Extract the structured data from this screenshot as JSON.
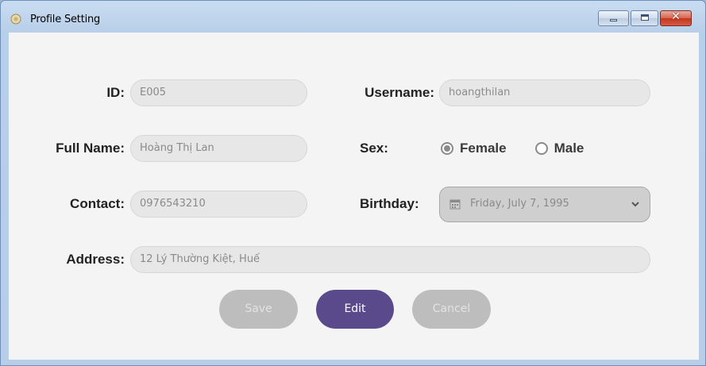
{
  "window": {
    "title": "Profile Setting",
    "controls": {
      "minimize": "minimize",
      "maximize": "maximize",
      "close": "✕"
    }
  },
  "form": {
    "id": {
      "label": "ID:",
      "value": "E005"
    },
    "username": {
      "label": "Username:",
      "value": "hoangthilan"
    },
    "full_name": {
      "label": "Full Name:",
      "value": "Hoàng Thị Lan"
    },
    "sex": {
      "label": "Sex:",
      "options": [
        {
          "label": "Female",
          "selected": true
        },
        {
          "label": "Male",
          "selected": false
        }
      ]
    },
    "contact": {
      "label": "Contact:",
      "value": "0976543210"
    },
    "birthday": {
      "label": "Birthday:",
      "value": "Friday, July 7, 1995",
      "icon": "calendar-icon"
    },
    "address": {
      "label": "Address:",
      "value": "12 Lý Thường Kiệt, Huế"
    }
  },
  "buttons": {
    "save": {
      "label": "Save",
      "enabled": false
    },
    "edit": {
      "label": "Edit",
      "enabled": true
    },
    "cancel": {
      "label": "Cancel",
      "enabled": false
    }
  },
  "colors": {
    "accent": "#5b4a8b",
    "disabled_button": "#bdbdbd",
    "field_background": "#e7e7e7",
    "client_background": "#f4f4f4"
  }
}
